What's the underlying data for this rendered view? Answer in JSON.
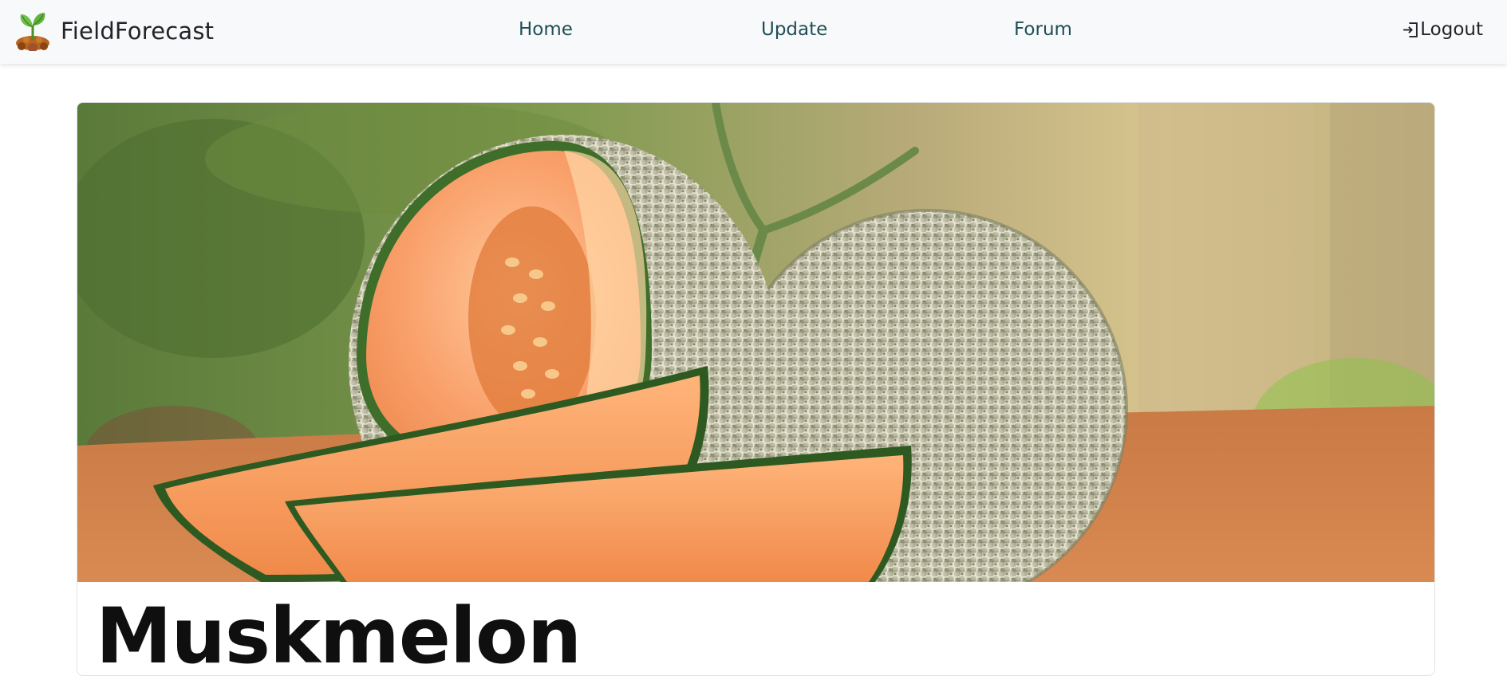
{
  "navbar": {
    "brand": {
      "name": "FieldForecast",
      "logo_icon": "sprout-icon"
    },
    "links": [
      {
        "label": "Home"
      },
      {
        "label": "Update"
      },
      {
        "label": "Forum"
      }
    ],
    "logout": {
      "label": "Logout",
      "icon": "logout-icon"
    },
    "colors": {
      "background": "#f8f9fa",
      "link": "#1f4f56",
      "text": "#212529"
    }
  },
  "card": {
    "image": {
      "subject": "cantaloupe melons, one halved, with sliced wedges on a wooden table"
    },
    "title": "Muskmelon"
  }
}
